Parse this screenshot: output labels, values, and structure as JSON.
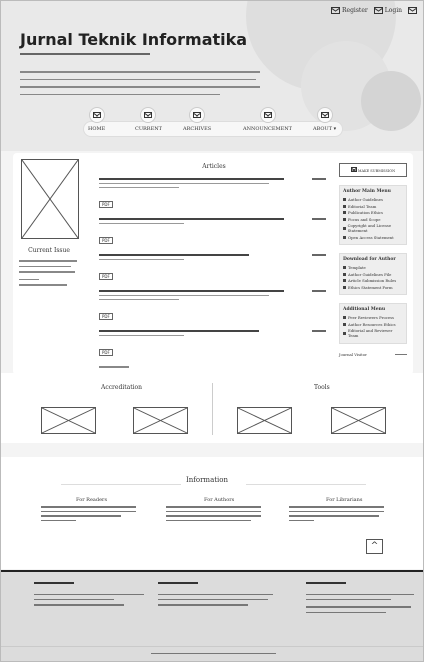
{
  "header": {
    "title": "Jurnal Teknik Informatika",
    "top_links": [
      {
        "label": "Register",
        "icon": "envelope-icon"
      },
      {
        "label": "Login",
        "icon": "envelope-icon"
      }
    ]
  },
  "nav": {
    "items": [
      {
        "label": "HOME",
        "icon": "envelope-icon"
      },
      {
        "label": "CURRENT",
        "icon": "envelope-icon"
      },
      {
        "label": "ARCHIVES",
        "icon": "envelope-icon"
      },
      {
        "label": "ANNOUNCEMENT",
        "icon": "envelope-icon"
      },
      {
        "label": "ABOUT ▾",
        "icon": "envelope-icon"
      }
    ]
  },
  "current_issue": {
    "label": "Current Issue"
  },
  "articles": {
    "heading": "Articles",
    "pdf_label": "PDF"
  },
  "sidebar": {
    "make_submission": "MAKE SUBMISSION",
    "author_menu": {
      "title": "Author Main Menu",
      "items": [
        "Author Guidelines",
        "Editorial Team",
        "Publication Ethics",
        "Focus and Scope",
        "Copyright and License Statement",
        "Open Access Statement"
      ]
    },
    "download": {
      "title": "Download for Author",
      "items": [
        "Template",
        "Author Guidelines File",
        "Article Submission Rules",
        "Ethics Statement Form"
      ]
    },
    "additional": {
      "title": "Additional Menu",
      "items": [
        "Peer Reviewers Process",
        "Author Resources Ethics",
        "Editorial and Reviewer Team"
      ]
    },
    "journal_visitor": "Journal Visitor"
  },
  "accreditation": {
    "title": "Accreditation"
  },
  "tools": {
    "title": "Tools"
  },
  "information": {
    "title": "Information",
    "readers": "For Readers",
    "authors": "For Authors",
    "librarians": "For Librarians"
  },
  "scroll_top": "^"
}
